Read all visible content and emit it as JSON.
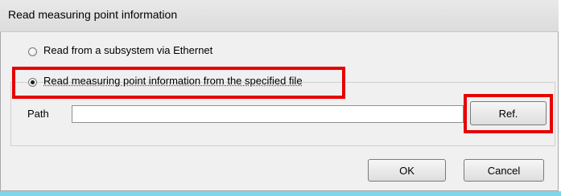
{
  "dialog": {
    "title": "Read measuring point information"
  },
  "options": {
    "ethernet_label": "Read from a subsystem via Ethernet",
    "file_label": "Read measuring point information from the specified file",
    "selected": "file"
  },
  "path": {
    "label": "Path",
    "value": "",
    "ref_button": "Ref."
  },
  "buttons": {
    "ok": "OK",
    "cancel": "Cancel"
  },
  "colors": {
    "highlight": "#e80000",
    "bottom_edge": "#7fd6ea"
  }
}
